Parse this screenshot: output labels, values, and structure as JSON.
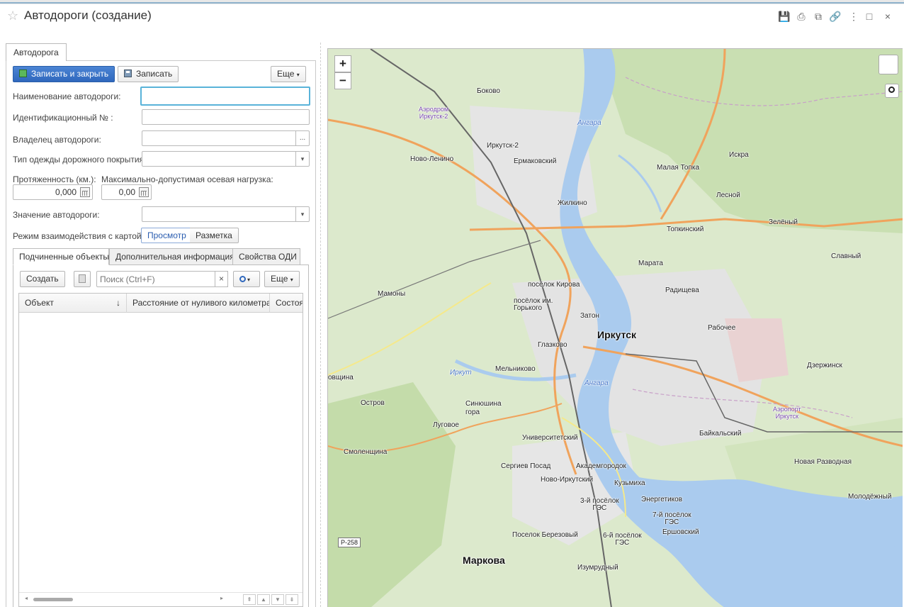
{
  "window": {
    "title": "Автодороги (создание)",
    "star_icon": "☆",
    "controls": {
      "save_icon": "💾",
      "print_icon": "⎙",
      "preview_icon": "⧉",
      "link_icon": "🔗",
      "more_icon": "⋮",
      "maximize_icon": "□",
      "close_icon": "×"
    }
  },
  "form": {
    "tab_label": "Автодорога",
    "toolbar": {
      "save_close_label": "Записать и закрыть",
      "save_label": "Записать",
      "more_label": "Еще"
    },
    "fields": {
      "name_label": "Наименование автодороги:",
      "name_value": "",
      "id_label": "Идентификационный № :",
      "id_value": "",
      "owner_label": "Владелец автодороги:",
      "owner_value": "",
      "owner_button": "...",
      "surface_label": "Тип одежды дорожного покрытия:",
      "surface_value": "",
      "length_label": "Протяженность (км.):",
      "length_value": "0,000",
      "axle_label": "Максимально-допустимая осевая нагрузка:",
      "axle_value": "0,00",
      "significance_label": "Значение автодороги:",
      "significance_value": ""
    },
    "map_mode": {
      "label": "Режим взаимодействия с картой:",
      "view_label": "Просмотр",
      "markup_label": "Разметка"
    },
    "subtabs": [
      "Подчиненные объекты",
      "Дополнительная информация",
      "Свойства ОДИ"
    ],
    "list": {
      "create_label": "Создать",
      "search_placeholder": "Поиск (Ctrl+F)",
      "clear_icon": "×",
      "search_icon": "🔍",
      "more_label": "Еще",
      "columns": [
        "Объект",
        "Расстояние от нуливого километра",
        "Состоя"
      ],
      "sort_arrow": "↓",
      "rows": []
    }
  },
  "map": {
    "zoom_in": "+",
    "zoom_out": "−",
    "places": [
      {
        "name": "Боково",
        "cls": "mid"
      },
      {
        "name": "Аэродром\nИркутск-2",
        "cls": "airport"
      },
      {
        "name": "Ангара",
        "cls": "river"
      },
      {
        "name": "Иркутск-2",
        "cls": "mid"
      },
      {
        "name": "Ново-Ленино",
        "cls": "mid"
      },
      {
        "name": "Ермаковский",
        "cls": "mid"
      },
      {
        "name": "Искра",
        "cls": "mid"
      },
      {
        "name": "Малая Топка",
        "cls": ""
      },
      {
        "name": "Лесной",
        "cls": "mid"
      },
      {
        "name": "Жилкино",
        "cls": "mid"
      },
      {
        "name": "Зелёный",
        "cls": "mid"
      },
      {
        "name": "Топкинский",
        "cls": "mid"
      },
      {
        "name": "Славный",
        "cls": "mid"
      },
      {
        "name": "Марата",
        "cls": "mid"
      },
      {
        "name": "Мамоны",
        "cls": ""
      },
      {
        "name": "посёлок Кирова",
        "cls": "mid"
      },
      {
        "name": "Радищева",
        "cls": "mid"
      },
      {
        "name": "посёлок им.\nГорького",
        "cls": ""
      },
      {
        "name": "Затон",
        "cls": "mid"
      },
      {
        "name": "Иркутск",
        "cls": "big"
      },
      {
        "name": "Рабочее",
        "cls": "mid"
      },
      {
        "name": "Глазково",
        "cls": "mid"
      },
      {
        "name": "Мельниково",
        "cls": "mid"
      },
      {
        "name": "Иркут",
        "cls": "river"
      },
      {
        "name": "Ангара",
        "cls": "river"
      },
      {
        "name": "Дзержинск",
        "cls": ""
      },
      {
        "name": "Аэропорт\nИркутск",
        "cls": "airport"
      },
      {
        "name": "Остров",
        "cls": ""
      },
      {
        "name": "Синюшина\nгора",
        "cls": "mid"
      },
      {
        "name": "Луговое",
        "cls": "mid"
      },
      {
        "name": "Университетский",
        "cls": "mid"
      },
      {
        "name": "Байкальский",
        "cls": "mid"
      },
      {
        "name": "Смоленщина",
        "cls": ""
      },
      {
        "name": "Новая Разводная",
        "cls": ""
      },
      {
        "name": "Сергиев Посад",
        "cls": "mid"
      },
      {
        "name": "Академгородок",
        "cls": "mid"
      },
      {
        "name": "Ново-Иркутский",
        "cls": ""
      },
      {
        "name": "Кузьмиха",
        "cls": "mid"
      },
      {
        "name": "Энергетиков",
        "cls": "mid"
      },
      {
        "name": "3-й посёлок\nГЭС",
        "cls": ""
      },
      {
        "name": "7-й посёлок\nГЭС",
        "cls": ""
      },
      {
        "name": "Молодёжный",
        "cls": ""
      },
      {
        "name": "Ершовский",
        "cls": ""
      },
      {
        "name": "Поселок Березовый",
        "cls": ""
      },
      {
        "name": "6-й посёлок\nГЭС",
        "cls": ""
      },
      {
        "name": "Маркова",
        "cls": "big"
      },
      {
        "name": "Изумрудный",
        "cls": ""
      },
      {
        "name": "овщина",
        "cls": ""
      }
    ],
    "road_shield": "Р-258"
  }
}
